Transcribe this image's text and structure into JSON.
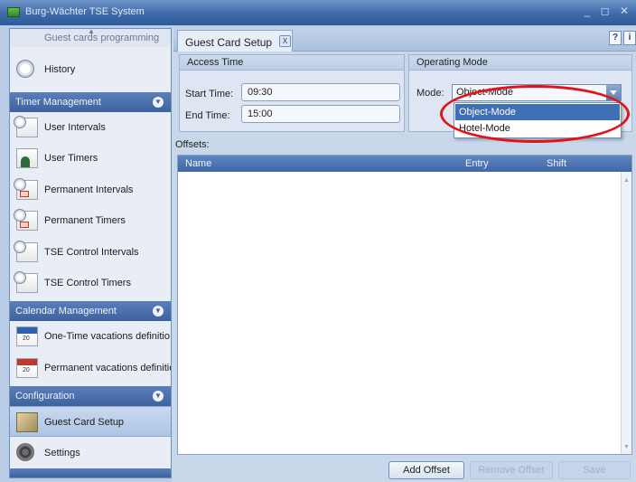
{
  "window": {
    "title": "Burg-Wächter  TSE   System",
    "controls": "_ ◻ ✕"
  },
  "sidebar": {
    "top_item": "Guest cards programming",
    "history": "History",
    "sections": [
      {
        "title": "Timer Management",
        "items": [
          "User Intervals",
          "User Timers",
          "Permanent Intervals",
          "Permanent Timers",
          "TSE Control Intervals",
          "TSE Control Timers"
        ]
      },
      {
        "title": "Calendar Management",
        "items": [
          "One-Time vacations definitio",
          "Permanent vacations definitic"
        ]
      },
      {
        "title": "Configuration",
        "items": [
          "Guest Card Setup",
          "Settings"
        ]
      }
    ],
    "selected": "Guest Card Setup"
  },
  "tab": {
    "label": "Guest Card Setup",
    "close": "X"
  },
  "help_buttons": [
    "?",
    "i"
  ],
  "access_time": {
    "title": "Access Time",
    "start_label": "Start Time:",
    "start_value": "09:30",
    "end_label": "End Time:",
    "end_value": "15:00"
  },
  "operating_mode": {
    "title": "Operating Mode",
    "mode_label": "Mode:",
    "selected": "Object-Mode",
    "options": [
      "Object-Mode",
      "Hotel-Mode"
    ]
  },
  "offsets": {
    "label": "Offsets:",
    "columns": [
      "Name",
      "Entry",
      "Shift"
    ]
  },
  "buttons": {
    "add_offset": "Add Offset",
    "remove_offset": "Remove Offset",
    "save": "Save"
  },
  "colors": {
    "accent": "#3f6fb5",
    "annotation": "#e0141a"
  }
}
